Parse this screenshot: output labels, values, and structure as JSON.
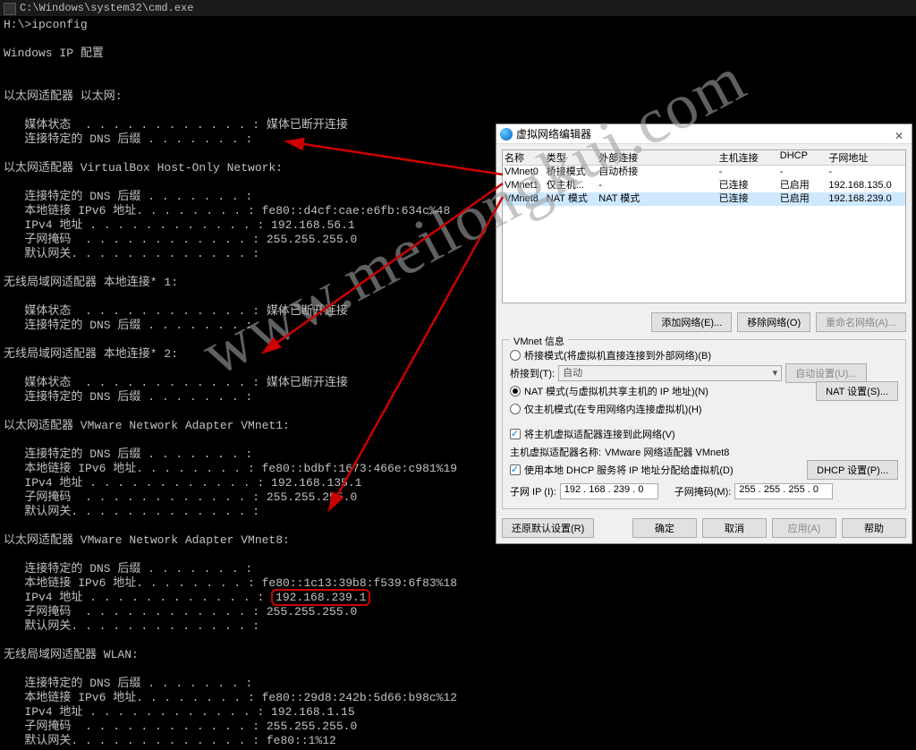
{
  "cmd": {
    "title": "C:\\Windows\\system32\\cmd.exe",
    "prompt": "H:\\>ipconfig",
    "header": "Windows IP 配置",
    "adapters": [
      {
        "name": "以太网适配器 以太网:",
        "lines": [
          "   媒体状态  . . . . . . . . . . . . : 媒体已断开连接",
          "   连接特定的 DNS 后缀 . . . . . . . :"
        ]
      },
      {
        "name": "以太网适配器 VirtualBox Host-Only Network:",
        "lines": [
          "   连接特定的 DNS 后缀 . . . . . . . :",
          "   本地链接 IPv6 地址. . . . . . . . : fe80::d4cf:cae:e6fb:634c%48",
          "   IPv4 地址 . . . . . . . . . . . . : 192.168.56.1",
          "   子网掩码  . . . . . . . . . . . . : 255.255.255.0",
          "   默认网关. . . . . . . . . . . . . :"
        ]
      },
      {
        "name": "无线局域网适配器 本地连接* 1:",
        "lines": [
          "   媒体状态  . . . . . . . . . . . . : 媒体已断开连接",
          "   连接特定的 DNS 后缀 . . . . . . . :"
        ]
      },
      {
        "name": "无线局域网适配器 本地连接* 2:",
        "lines": [
          "   媒体状态  . . . . . . . . . . . . : 媒体已断开连接",
          "   连接特定的 DNS 后缀 . . . . . . . :"
        ]
      },
      {
        "name": "以太网适配器 VMware Network Adapter VMnet1:",
        "lines": [
          "   连接特定的 DNS 后缀 . . . . . . . :",
          "   本地链接 IPv6 地址. . . . . . . . : fe80::bdbf:1673:466e:c981%19",
          "   IPv4 地址 . . . . . . . . . . . . : 192.168.135.1",
          "   子网掩码  . . . . . . . . . . . . : 255.255.255.0",
          "   默认网关. . . . . . . . . . . . . :"
        ]
      },
      {
        "name": "以太网适配器 VMware Network Adapter VMnet8:",
        "lines": [
          "   连接特定的 DNS 后缀 . . . . . . . :",
          "   本地链接 IPv6 地址. . . . . . . . : fe80::1c13:39b8:f539:6f83%18"
        ],
        "ipv4_label": "   IPv4 地址 . . . . . . . . . . . . : ",
        "ipv4_value": "192.168.239.1",
        "lines_after": [
          "   子网掩码  . . . . . . . . . . . . : 255.255.255.0",
          "   默认网关. . . . . . . . . . . . . :"
        ]
      },
      {
        "name": "无线局域网适配器 WLAN:",
        "lines": [
          "   连接特定的 DNS 后缀 . . . . . . . :",
          "   本地链接 IPv6 地址. . . . . . . . : fe80::29d8:242b:5d66:b98c%12",
          "   IPv4 地址 . . . . . . . . . . . . : 192.168.1.15",
          "   子网掩码  . . . . . . . . . . . . : 255.255.255.0",
          "   默认网关. . . . . . . . . . . . . : fe80::1%12"
        ]
      }
    ]
  },
  "dialog": {
    "title": "虚拟网络编辑器",
    "columns": {
      "name": "名称",
      "type": "类型",
      "ext": "外部连接",
      "host": "主机连接",
      "dhcp": "DHCP",
      "subnet": "子网地址"
    },
    "rows": [
      {
        "name": "VMnet0",
        "type": "桥接模式",
        "ext": "自动桥接",
        "host": "-",
        "dhcp": "-",
        "subnet": "-"
      },
      {
        "name": "VMnet1",
        "type": "仅主机...",
        "ext": "-",
        "host": "已连接",
        "dhcp": "已启用",
        "subnet": "192.168.135.0"
      },
      {
        "name": "VMnet8",
        "type": "NAT 模式",
        "ext": "NAT 模式",
        "host": "已连接",
        "dhcp": "已启用",
        "subnet": "192.168.239.0"
      }
    ],
    "btn_add": "添加网络(E)...",
    "btn_remove": "移除网络(O)",
    "btn_rename": "重命名网络(A)...",
    "group_legend": "VMnet 信息",
    "radio_bridge": "桥接模式(将虚拟机直接连接到外部网络)(B)",
    "bridge_label": "桥接到(T):",
    "bridge_value": "自动",
    "btn_auto": "自动设置(U)...",
    "radio_nat": "NAT 模式(与虚拟机共享主机的 IP 地址)(N)",
    "btn_nat": "NAT 设置(S)...",
    "radio_hostonly": "仅主机模式(在专用网络内连接虚拟机)(H)",
    "chk_connect": "将主机虚拟适配器连接到此网络(V)",
    "host_adapter_label": "主机虚拟适配器名称:",
    "host_adapter_value": "VMware 网络适配器 VMnet8",
    "chk_dhcp": "使用本地 DHCP 服务将 IP 地址分配给虚拟机(D)",
    "btn_dhcp": "DHCP 设置(P)...",
    "subnet_ip_label": "子网 IP (I):",
    "subnet_ip_value": "192 . 168 . 239 . 0",
    "subnet_mask_label": "子网掩码(M):",
    "subnet_mask_value": "255 . 255 . 255 . 0",
    "btn_restore": "还原默认设置(R)",
    "btn_ok": "确定",
    "btn_cancel": "取消",
    "btn_apply": "应用(A)",
    "btn_help": "帮助"
  },
  "watermark": "www.meilongkui.com"
}
